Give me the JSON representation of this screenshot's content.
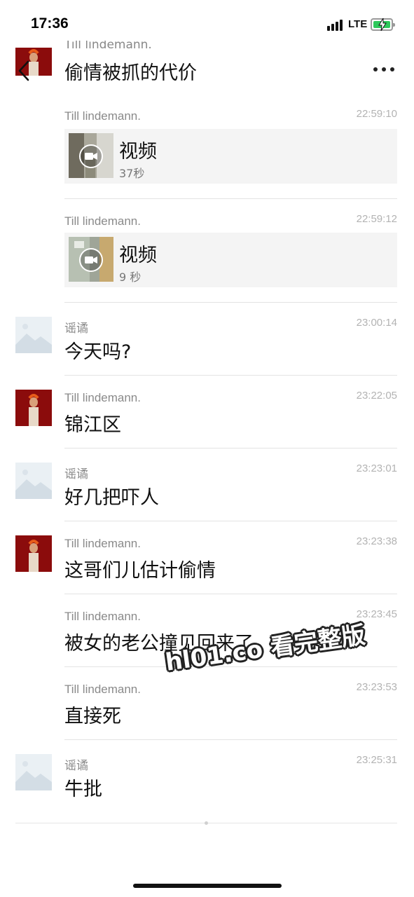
{
  "status_bar": {
    "time": "17:36",
    "network": "LTE"
  },
  "header": {
    "peek_name": "Till lindemann.",
    "title": "偷情被抓的代价"
  },
  "messages": [
    {
      "sender": "Till lindemann.",
      "time": "22:59:10",
      "video_title": "视频",
      "video_duration": "37秒"
    },
    {
      "sender": "Till lindemann.",
      "time": "22:59:12",
      "video_title": "视频",
      "video_duration": "9 秒"
    },
    {
      "sender": "谣谲",
      "time": "23:00:14",
      "text": "今天吗?"
    },
    {
      "sender": "Till lindemann.",
      "time": "23:22:05",
      "text": "锦江区"
    },
    {
      "sender": "谣谲",
      "time": "23:23:01",
      "text": "好几把吓人"
    },
    {
      "sender": "Till lindemann.",
      "time": "23:23:38",
      "text": "这哥们儿估计偷情"
    },
    {
      "sender": "Till lindemann.",
      "time": "23:23:45",
      "text": "被女的老公撞见回来了"
    },
    {
      "sender": "Till lindemann.",
      "time": "23:23:53",
      "text": "直接死"
    },
    {
      "sender": "谣谲",
      "time": "23:25:31",
      "text": "牛批"
    }
  ],
  "watermark": "hl01.co 看完整版",
  "colors": {
    "avatar_red": "#8b0c0c",
    "battery_green": "#2ec85b"
  },
  "icons": {
    "back": "chevron-left-icon",
    "more": "more-dots-icon",
    "video": "video-camera-icon"
  }
}
